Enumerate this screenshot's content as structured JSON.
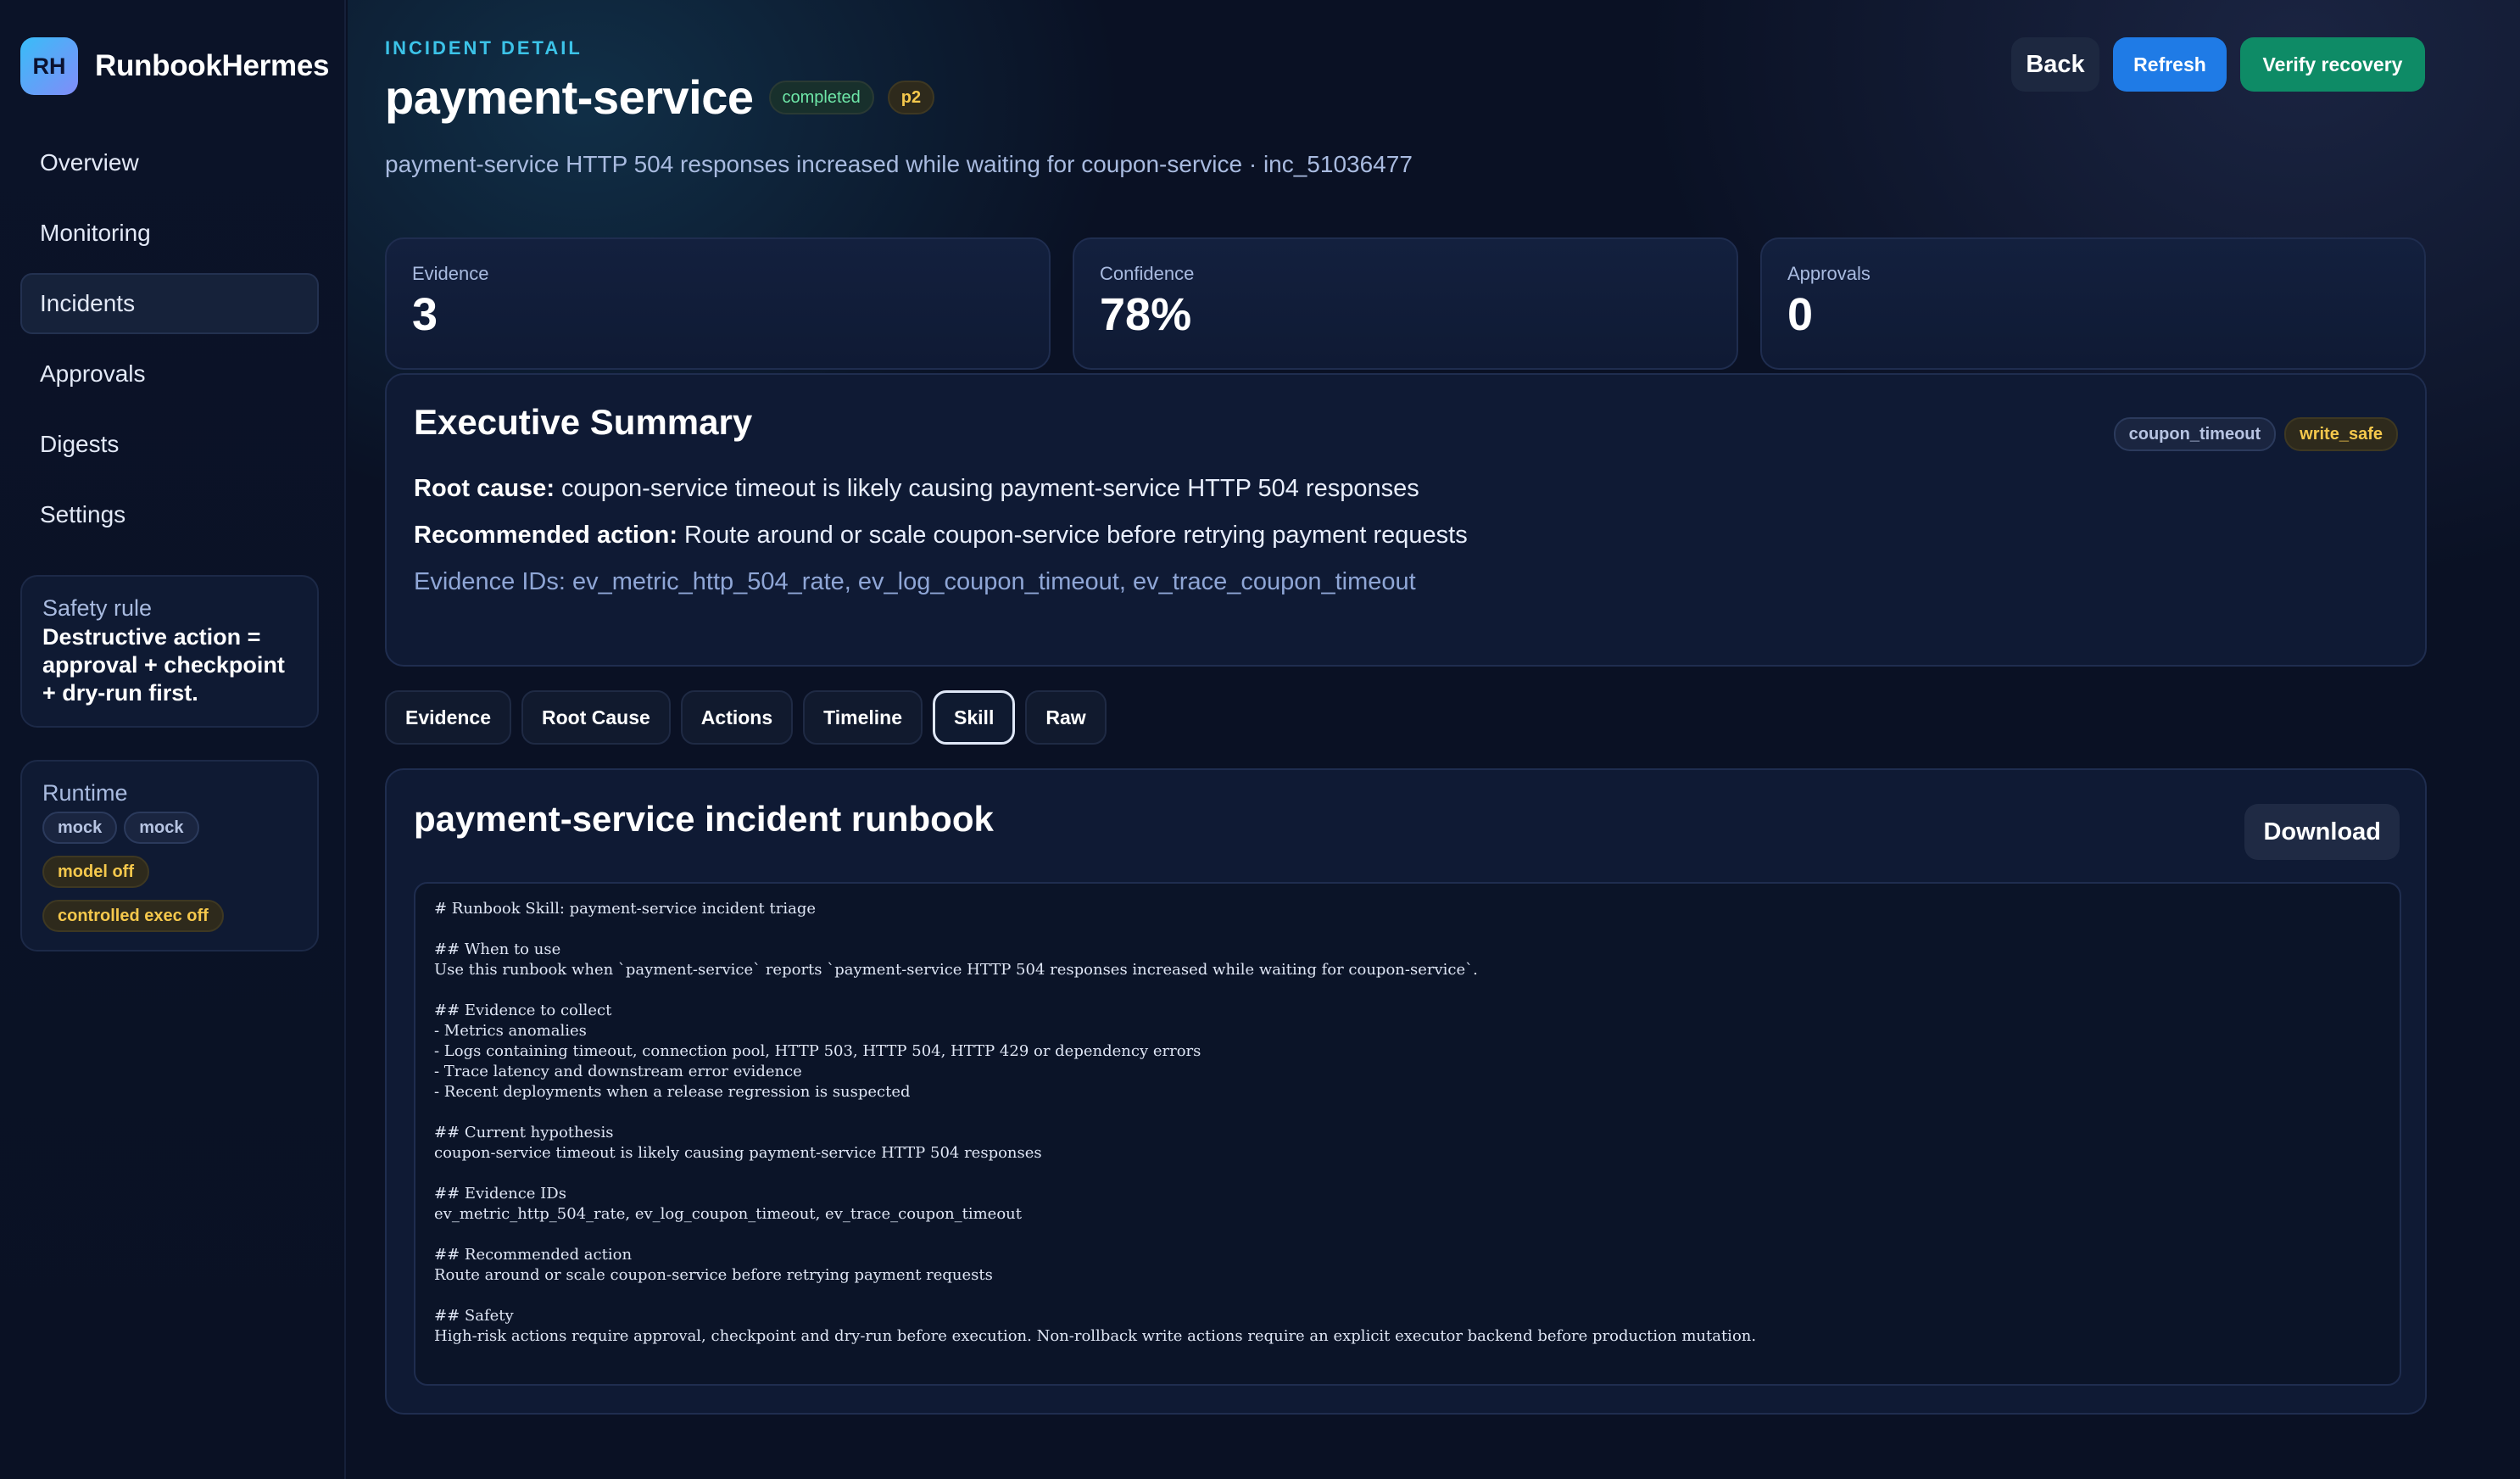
{
  "sidebar": {
    "brand_initials": "RH",
    "brand_name": "RunbookHermes",
    "nav": [
      "Overview",
      "Monitoring",
      "Incidents",
      "Approvals",
      "Digests",
      "Settings"
    ],
    "active_nav": "Incidents",
    "safety": {
      "title": "Safety rule",
      "rule": "Destructive action = approval + checkpoint + dry-run first."
    },
    "runtime": {
      "title": "Runtime",
      "chips": [
        "mock",
        "mock",
        "model off",
        "controlled exec off"
      ]
    }
  },
  "header": {
    "eyebrow": "INCIDENT DETAIL",
    "title": "payment-service",
    "status_badge": "completed",
    "priority_badge": "p2",
    "subtitle": "payment-service HTTP 504 responses increased while waiting for coupon-service · inc_51036477",
    "buttons": {
      "back": "Back",
      "refresh": "Refresh",
      "verify": "Verify recovery"
    }
  },
  "stats": [
    {
      "label": "Evidence",
      "value": "3"
    },
    {
      "label": "Confidence",
      "value": "78%"
    },
    {
      "label": "Approvals",
      "value": "0"
    }
  ],
  "summary": {
    "title": "Executive Summary",
    "tags": [
      "coupon_timeout",
      "write_safe"
    ],
    "root_cause_label": "Root cause:",
    "root_cause": " coupon-service timeout is likely causing payment-service HTTP 504 responses",
    "action_label": "Recommended action:",
    "action": " Route around or scale coupon-service before retrying payment requests",
    "evidence_ids": "Evidence IDs: ev_metric_http_504_rate, ev_log_coupon_timeout, ev_trace_coupon_timeout"
  },
  "tabs": [
    "Evidence",
    "Root Cause",
    "Actions",
    "Timeline",
    "Skill",
    "Raw"
  ],
  "active_tab": "Skill",
  "skill": {
    "title": "payment-service incident runbook",
    "download_label": "Download",
    "content": "# Runbook Skill: payment-service incident triage\n\n## When to use\nUse this runbook when `payment-service` reports `payment-service HTTP 504 responses increased while waiting for coupon-service`.\n\n## Evidence to collect\n- Metrics anomalies\n- Logs containing timeout, connection pool, HTTP 503, HTTP 504, HTTP 429 or dependency errors\n- Trace latency and downstream error evidence\n- Recent deployments when a release regression is suspected\n\n## Current hypothesis\ncoupon-service timeout is likely causing payment-service HTTP 504 responses\n\n## Evidence IDs\nev_metric_http_504_rate, ev_log_coupon_timeout, ev_trace_coupon_timeout\n\n## Recommended action\nRoute around or scale coupon-service before retrying payment requests\n\n## Safety\nHigh-risk actions require approval, checkpoint and dry-run before execution. Non-rollback write actions require an explicit executor backend before production mutation."
  }
}
